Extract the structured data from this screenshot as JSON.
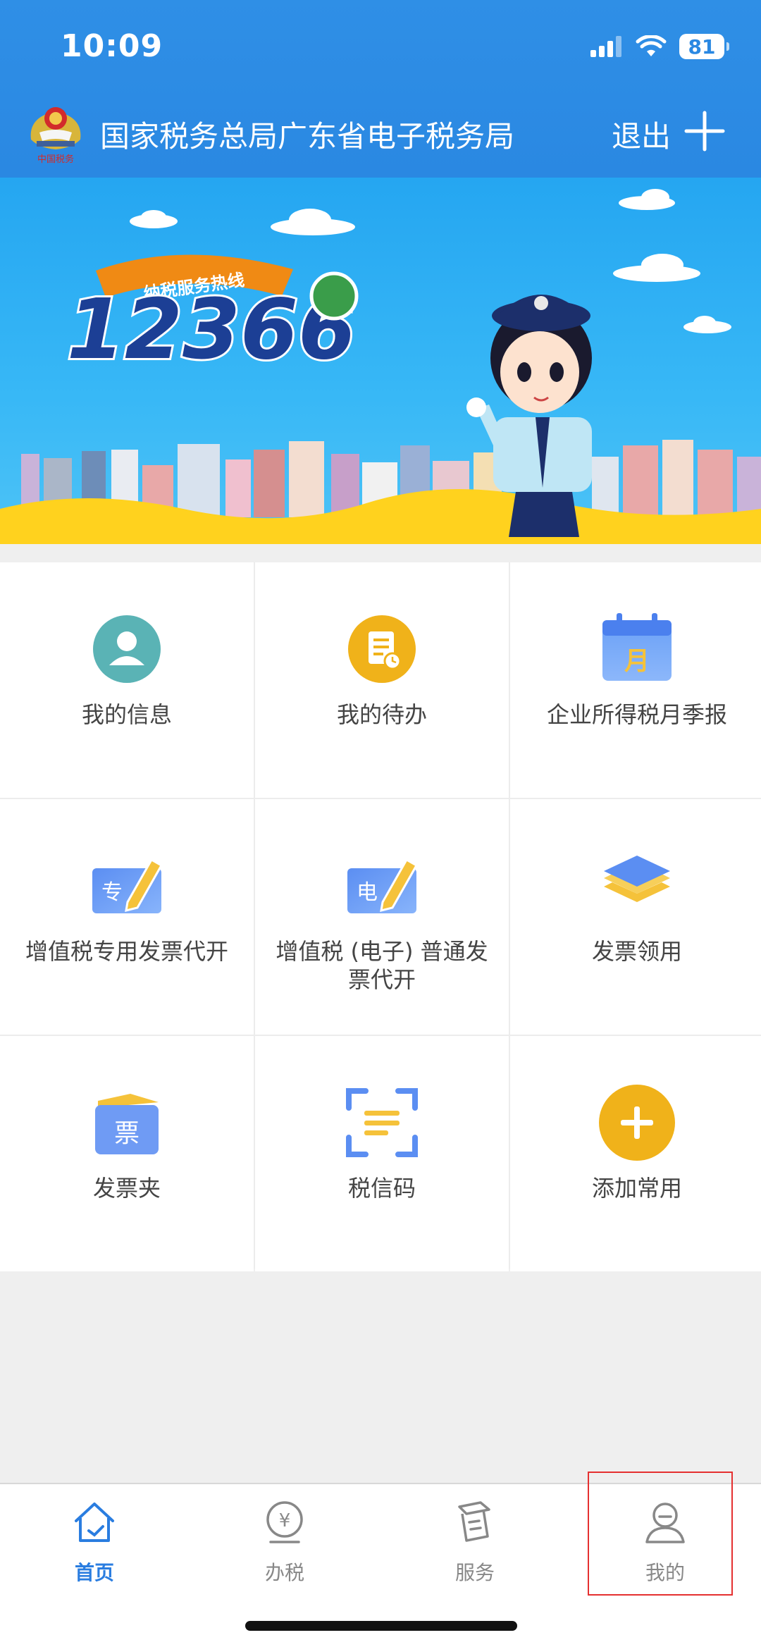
{
  "status_bar": {
    "time": "10:09",
    "battery": "81"
  },
  "header": {
    "title": "国家税务总局广东省电子税务局",
    "logout_label": "退出",
    "emblem_text": "中国税务"
  },
  "banner": {
    "ribbon_text": "纳税服务热线",
    "hotline_digits": "12366"
  },
  "grid": {
    "items": [
      {
        "label": "我的信息",
        "icon": "user-info-icon",
        "color": "#5ab3b5"
      },
      {
        "label": "我的待办",
        "icon": "todo-icon",
        "color": "#f0b21a"
      },
      {
        "label": "企业所得税月季报",
        "icon": "calendar-month-icon",
        "badge": "月",
        "color": "#5b8ef2"
      },
      {
        "label": "增值税专用发票代开",
        "icon": "special-invoice-edit-icon",
        "badge": "专",
        "color": "#5b8ef2"
      },
      {
        "label": "增值税 (电子) 普通发票代开",
        "icon": "e-invoice-edit-icon",
        "badge": "电",
        "color": "#5b8ef2"
      },
      {
        "label": "发票领用",
        "icon": "layers-icon",
        "color": "#5b8ef2"
      },
      {
        "label": "发票夹",
        "icon": "invoice-folder-icon",
        "badge": "票",
        "color": "#5b8ef2"
      },
      {
        "label": "税信码",
        "icon": "scan-code-icon",
        "color": "#f0b21a"
      },
      {
        "label": "添加常用",
        "icon": "add-circle-icon",
        "color": "#f0b21a"
      }
    ]
  },
  "tabbar": {
    "tabs": [
      {
        "label": "首页",
        "icon": "home-icon",
        "active": true
      },
      {
        "label": "办税",
        "icon": "yuan-coin-icon",
        "active": false
      },
      {
        "label": "服务",
        "icon": "service-icon",
        "active": false
      },
      {
        "label": "我的",
        "icon": "profile-icon",
        "active": false
      }
    ]
  },
  "colors": {
    "primary": "#2a88e2",
    "active_tab": "#2a7de0",
    "highlight": "#e53030"
  }
}
